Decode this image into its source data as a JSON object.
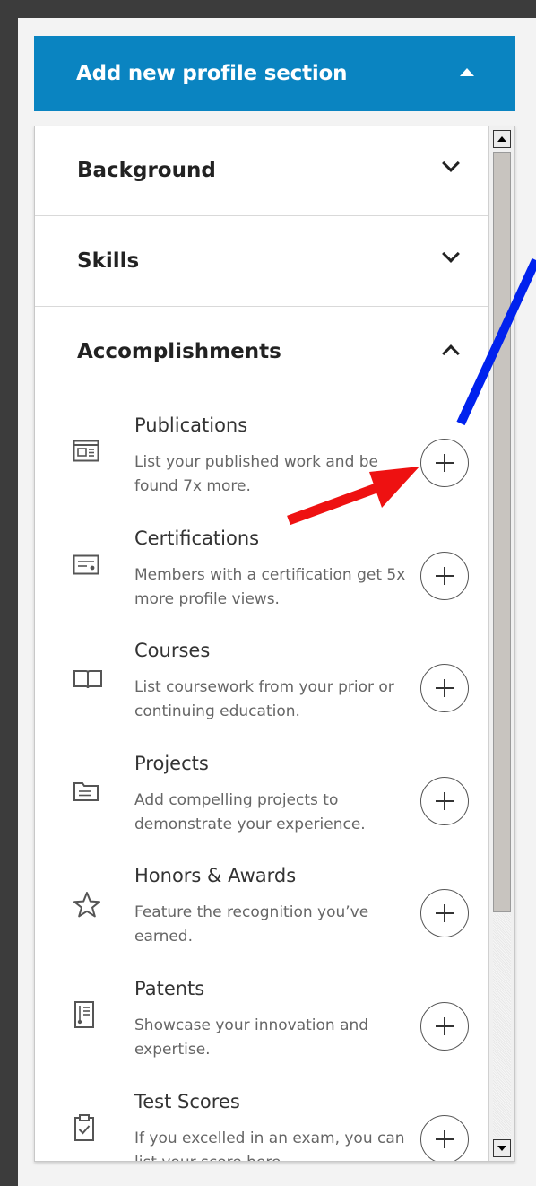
{
  "header": {
    "title": "Add new profile section"
  },
  "sections": [
    {
      "title": "Background"
    },
    {
      "title": "Skills"
    },
    {
      "title": "Accomplishments"
    }
  ],
  "accomplishments": {
    "items": [
      {
        "title": "Publications",
        "description": "List your published work and be found 7x more.",
        "icon": "publication-icon"
      },
      {
        "title": "Certifications",
        "description": "Members with a certification get 5x more profile views.",
        "icon": "certificate-icon"
      },
      {
        "title": "Courses",
        "description": "List coursework from your prior or continuing education.",
        "icon": "book-icon"
      },
      {
        "title": "Projects",
        "description": "Add compelling projects to demonstrate your experience.",
        "icon": "folder-icon"
      },
      {
        "title": "Honors & Awards",
        "description": "Feature the recognition you’ve earned.",
        "icon": "star-icon"
      },
      {
        "title": "Patents",
        "description": "Showcase your innovation and expertise.",
        "icon": "patent-icon"
      },
      {
        "title": "Test Scores",
        "description": "If you excelled in an exam, you can list your score here.",
        "icon": "clipboard-check-icon"
      }
    ]
  },
  "colors": {
    "header_bg": "#0a84c1",
    "annotation_arrow_red": "#ee1111",
    "annotation_line_blue": "#0022ee"
  }
}
